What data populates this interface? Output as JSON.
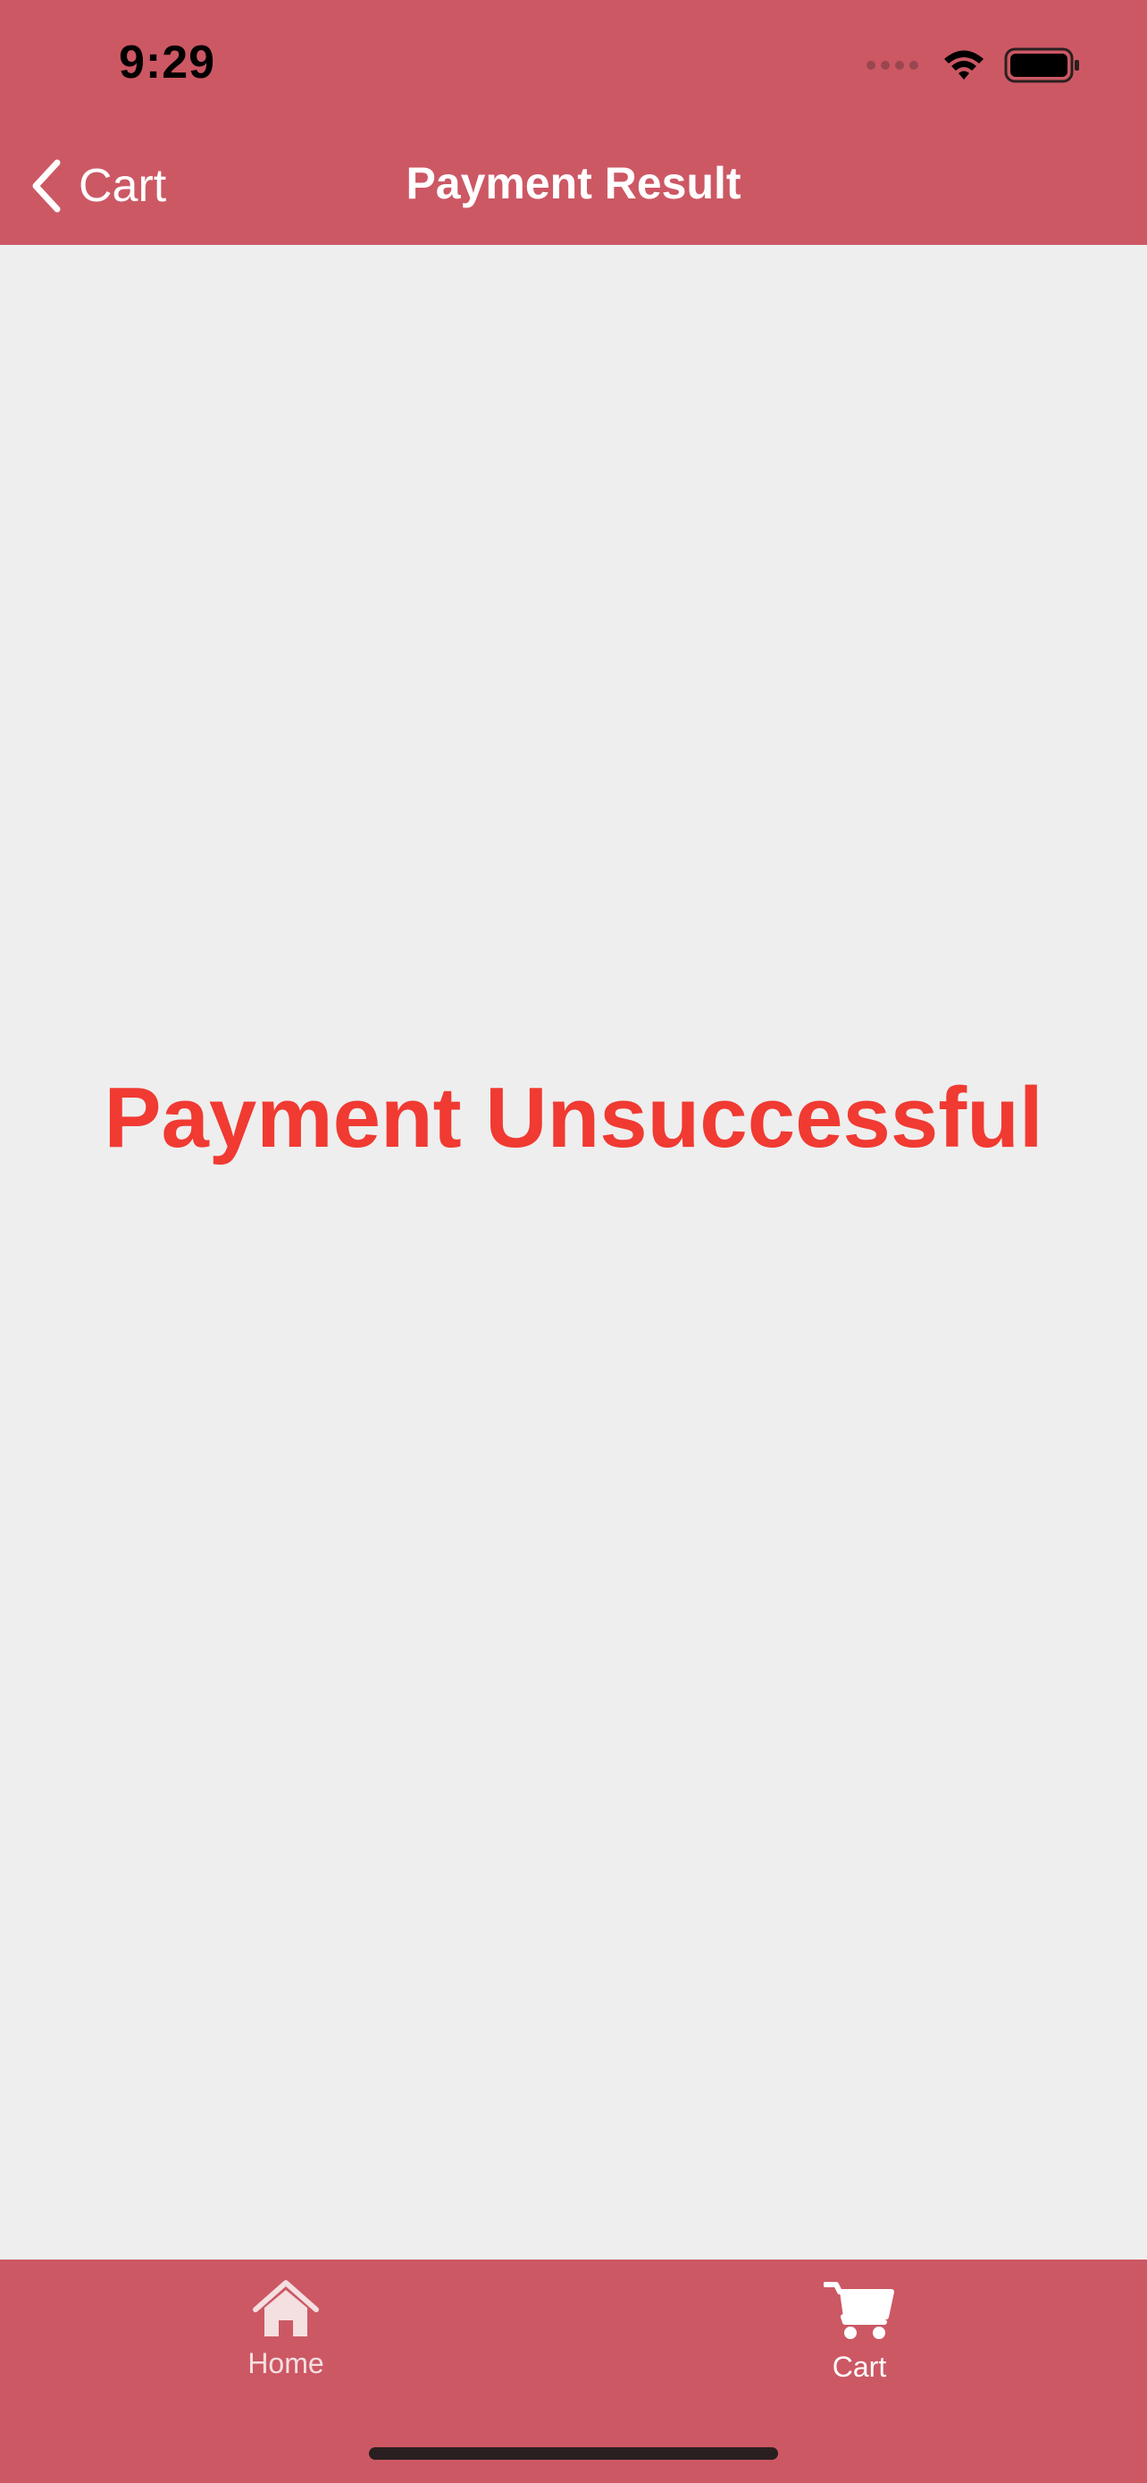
{
  "status_bar": {
    "time": "9:29"
  },
  "nav": {
    "back_label": "Cart",
    "title": "Payment Result"
  },
  "main": {
    "message": "Payment Unsuccessful"
  },
  "tab_bar": {
    "tabs": [
      {
        "label": "Home",
        "icon": "home-icon"
      },
      {
        "label": "Cart",
        "icon": "cart-icon",
        "selected": true
      }
    ]
  },
  "colors": {
    "brand": "#cc5864",
    "error": "#f03a32",
    "background": "#eeeeee"
  }
}
